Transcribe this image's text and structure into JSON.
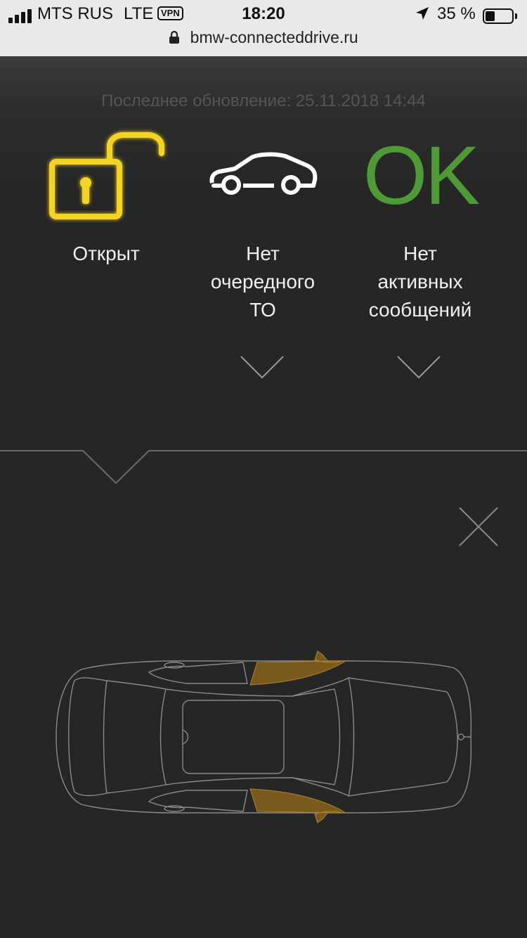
{
  "status_bar": {
    "carrier": "MTS RUS",
    "network": "LTE",
    "vpn": "VPN",
    "time": "18:20",
    "battery_percent": "35 %",
    "battery_level": 0.35,
    "url": "bmw-connecteddrive.ru"
  },
  "header": {
    "last_update": "Последнее обновление: 25.11.2018 14:44"
  },
  "status_items": [
    {
      "icon": "unlocked-padlock-icon",
      "label": "Открыт",
      "color": "#f4d324"
    },
    {
      "icon": "car-side-icon",
      "label_lines": [
        "Нет",
        "очередного",
        "ТО"
      ],
      "color": "#ffffff"
    },
    {
      "icon_text": "OK",
      "label_lines": [
        "Нет",
        "активных",
        "сообщений"
      ],
      "color": "#4e9a37"
    }
  ],
  "colors": {
    "background": "#262626",
    "accent_yellow": "#f4d324",
    "ok_green": "#4e9a37",
    "door_open": "#7a5a1c",
    "outline": "#8a8a8a"
  },
  "car_diagram": {
    "open_doors": [
      "front-left",
      "front-right"
    ]
  }
}
